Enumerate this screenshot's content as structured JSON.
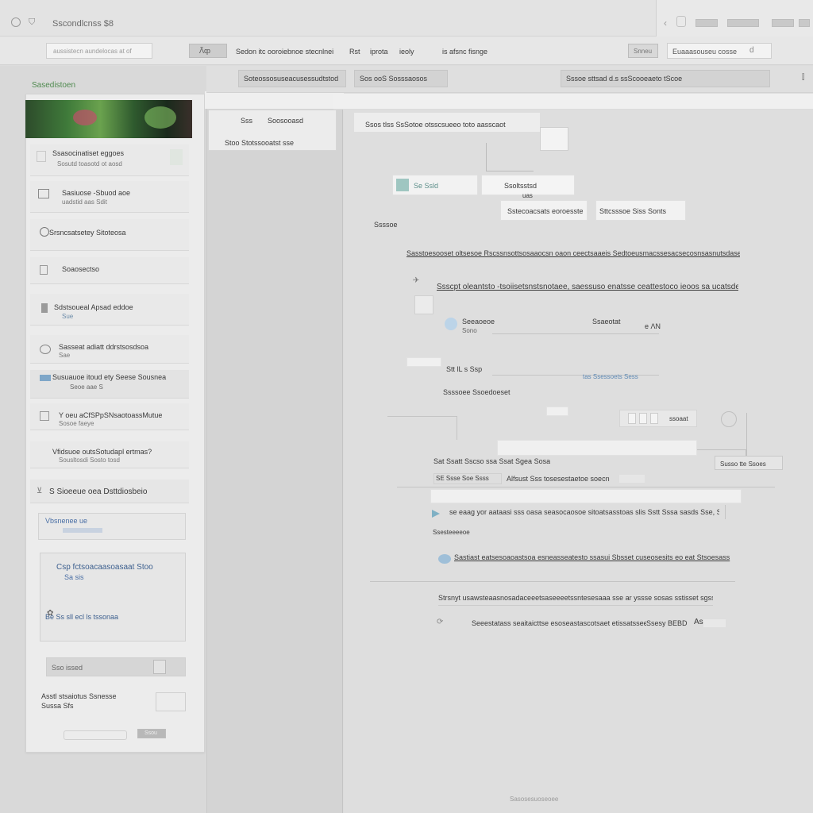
{
  "window": {
    "title": "Sscondlcnss  $8",
    "right_btns": [
      "",
      "",
      ""
    ]
  },
  "toolbar": {
    "address_placeholder": "aussistecn aundelocas at of",
    "btn_small": "Ʌ̃ȹ",
    "menu_text_1": "Sedon itc ooroiebnoe stecnlnei",
    "menu_text_2": "Rst",
    "menu_text_3": "iprota",
    "menu_text_4": "ieoly",
    "menu_text_5": "is afsnc fisnge",
    "right_btn": "Snneu",
    "right_field": "Euaaasouseu cosse",
    "right_icon": "d"
  },
  "sidebar": {
    "header": "Sasedistoen",
    "thumbnail_icon": "plant-image",
    "items": [
      {
        "title": "Ssasocinatiset eggoes",
        "sub": "Sosutd toasotd ot aosd"
      },
      {
        "title": "Sasiuose ‑Sbuod aoe",
        "sub": "uadstid aas Sdit"
      },
      {
        "title": "Srsncsatsetey Sitoteosa",
        "sub": ""
      },
      {
        "title": "Soaosectso",
        "sub": ""
      },
      {
        "title": "Sdstsoueal Apsad eddoe",
        "sub": "Sue"
      },
      {
        "title": "Sasseat adiatt ddrstsosdsoa",
        "sub": "Sae"
      },
      {
        "title": "Susuauoe itoud ety Seese Sousnea",
        "sub": "Seoe aae S"
      },
      {
        "title": "Y oeu aCfSPpSNsaotoassMutue",
        "sub": "Sosoe faeye"
      },
      {
        "title": "Vfidsuoe outsSotudapl ertmas?",
        "sub": "Sousltosdi Sosto tosd"
      },
      {
        "title": "S Sioeeue oea Dsttdiosbeio",
        "sub": ""
      }
    ],
    "link_box": "Vbsnenee ue",
    "promo_title": "Csp fctsoacaasoasaat Stoo",
    "promo_sub": "Sa sis",
    "promo_link": "Be Ss sll ecl ls tssonaa",
    "search_placeholder": "Sso issed",
    "footer_title": "Asstl stsaiotus Ssnesse",
    "footer_sub": "Sussa Sfs",
    "footer_btn": "Ssou"
  },
  "middle": {
    "pop_line1_a": "Sss",
    "pop_line1_b": "Soosooasd",
    "pop_line2": "Stoo  Stotssooatst sse"
  },
  "tabs": [
    {
      "label": "Soteossosuseacusessudtstod"
    },
    {
      "label": "Sos ooS  Sosssaosos"
    },
    {
      "label": "Sssoe sttsad d.s ssScooeaeto tScoe"
    }
  ],
  "main": {
    "breadcrumb": "Ssos tlss SsSotoe otsscsueeo toto aasscaot",
    "chip_left": "Se Ssld",
    "chip_mid": "Ssoltsstsd",
    "chip_small": "uas",
    "chip_left2": "Sstecoacsats eoroesste",
    "chip_right2": "Sttcsssoe Siss Sonts",
    "section_label": "Ssssoe",
    "heading": "Sasstoesooset oltsesoe Rscssnsottsosaaocsn oaon ceectsaaeis Sedtoeusmacssesacsecosnsasnutsdasessasnsstsdesasng",
    "question": "Ssscpt oleantsto ‑tsoiisetsnstsnotaee, saessuso enatsse ceattestoco ieoos sa ucatsdeets",
    "row_title": "Seeaoeoe",
    "row_sub": "Sono",
    "row_right": "Ssaeotat",
    "row_right_sub": "e ɅN",
    "small_field": "",
    "sub_label": "Stt lL s Ssp",
    "link_1": "tas Ssessoets Sess",
    "label_2": "Ssssoee Ssoedoeset",
    "toggle_label": "ssoaat",
    "row3_a": "Sat Ssatt  Sscso ssa Ssat Sgea Sosa",
    "row3_right": "Susso tte Ssoes",
    "row4_a": "SE Ssse Soe Ssss",
    "row4_b": "Alfsust Sss tosesestaetoe soecn",
    "row5": "se eaag yor aataasi sss oasa seasocaosoe sitoatsasstoas slis Sstt Sssa sasds Sse, Sso",
    "section_label_2": "Ssesteeeeoe",
    "row6": "Sastiast eatsesoaoastsoa esneasseatesto  ssasui Sbsset cuseosesits eo eat Stsoesass",
    "row7": "Strsnyt usawsteaasnosadaceeetsaseeeetssntesesaaa sse ar yssse sosas sstisset sgsss ccso",
    "row8_a": "Seeestatass seaitaicttse esoseastascotsaet etissatssee",
    "row8_b": "Ssesy BEBD",
    "row8_c": "As",
    "footer_link": "Sasosesuoseoee"
  }
}
